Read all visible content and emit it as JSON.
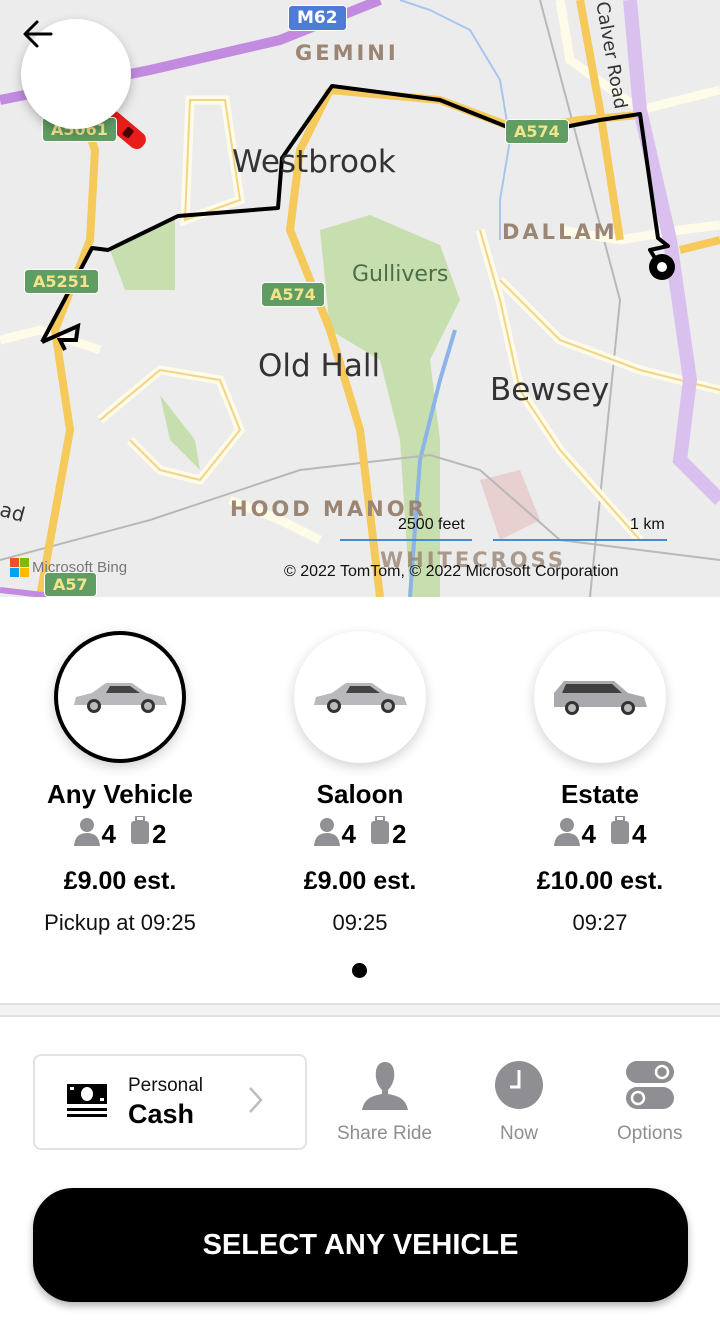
{
  "map": {
    "back_icon": "arrow-left-icon",
    "places": {
      "westbrook": "Westbrook",
      "old_hall": "Old Hall",
      "bewsey": "Bewsey",
      "gemini": "GEMINI",
      "dallam": "DALLAM",
      "hood_manor": "HOOD MANOR",
      "whitecross": "WHITECROSS",
      "gullivers": "Gullivers",
      "calver_road": "Calver Road",
      "road_partial": "ad"
    },
    "road_shields": {
      "m62": "M62",
      "a574_top": "A574",
      "a574_mid": "A574",
      "a5251": "A5251",
      "a57": "A57",
      "a5061": "A5061"
    },
    "scale": {
      "imperial": "2500 feet",
      "metric": "1 km"
    },
    "bing_label": "Microsoft Bing",
    "attribution": "© 2022 TomTom, © 2022 Microsoft Corporation",
    "colors": {
      "route": "#000000",
      "motorway": "#c38be0",
      "major_road": "#f5c95a",
      "park": "#c7dfae",
      "water": "#8db4e8"
    }
  },
  "vehicles": [
    {
      "name": "Any Vehicle",
      "passengers": "4",
      "luggage": "2",
      "price": "£9.00 est.",
      "pickup": "Pickup at 09:25",
      "selected": true,
      "type": "saloon"
    },
    {
      "name": "Saloon",
      "passengers": "4",
      "luggage": "2",
      "price": "£9.00 est.",
      "pickup": "09:25",
      "selected": false,
      "type": "saloon"
    },
    {
      "name": "Estate",
      "passengers": "4",
      "luggage": "4",
      "price": "£10.00 est.",
      "pickup": "09:27",
      "selected": false,
      "type": "estate"
    }
  ],
  "pager": {
    "pages": 1,
    "current": 1
  },
  "payment": {
    "sub": "Personal",
    "main": "Cash",
    "icon": "cash-icon"
  },
  "actions": [
    {
      "label": "Share Ride",
      "icon": "person-icon"
    },
    {
      "label": "Now",
      "icon": "clock-icon"
    },
    {
      "label": "Options",
      "icon": "toggles-icon"
    }
  ],
  "cta": {
    "label": "SELECT ANY VEHICLE"
  }
}
